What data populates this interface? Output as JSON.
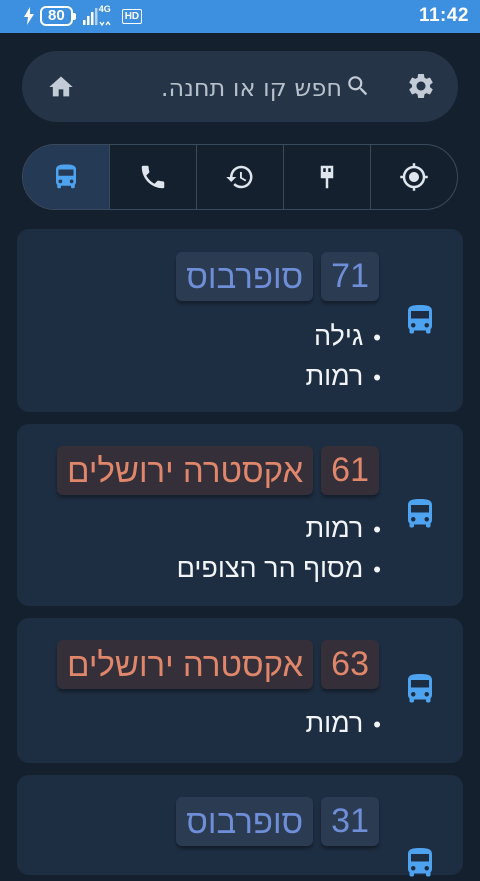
{
  "status_bar": {
    "battery_level": "80",
    "network_type": "4G",
    "hd_label": "HD",
    "time": "11:42",
    "color": "#3d8fe0"
  },
  "search": {
    "placeholder": "חפש קו או תחנה.",
    "value": "",
    "icons": [
      "home-icon",
      "search-icon",
      "gear-icon"
    ]
  },
  "tabs": [
    {
      "name": "bus",
      "icon": "bus-icon",
      "active": true
    },
    {
      "name": "phone",
      "icon": "phone-icon",
      "active": false
    },
    {
      "name": "history",
      "icon": "history-icon",
      "active": false
    },
    {
      "name": "stop",
      "icon": "bus-stop-icon",
      "active": false
    },
    {
      "name": "location",
      "icon": "gps-icon",
      "active": false
    }
  ],
  "lines": [
    {
      "number": "71",
      "operator": "סופרבוס",
      "color": "#6f8ed8",
      "destinations": [
        "גילה",
        "רמות"
      ]
    },
    {
      "number": "61",
      "operator": "אקסטרה ירושלים",
      "color": "#e0866a",
      "destinations": [
        "רמות",
        "מסוף הר הצופים"
      ]
    },
    {
      "number": "63",
      "operator": "אקסטרה ירושלים",
      "color": "#e0866a",
      "destinations": [
        "רמות"
      ]
    },
    {
      "number": "31",
      "operator": "סופרבוס",
      "color": "#6f8ed8",
      "destinations": []
    }
  ],
  "colors": {
    "background": "#14202e",
    "card": "#1e2e42",
    "accent_blue": "#4ea3f0"
  }
}
